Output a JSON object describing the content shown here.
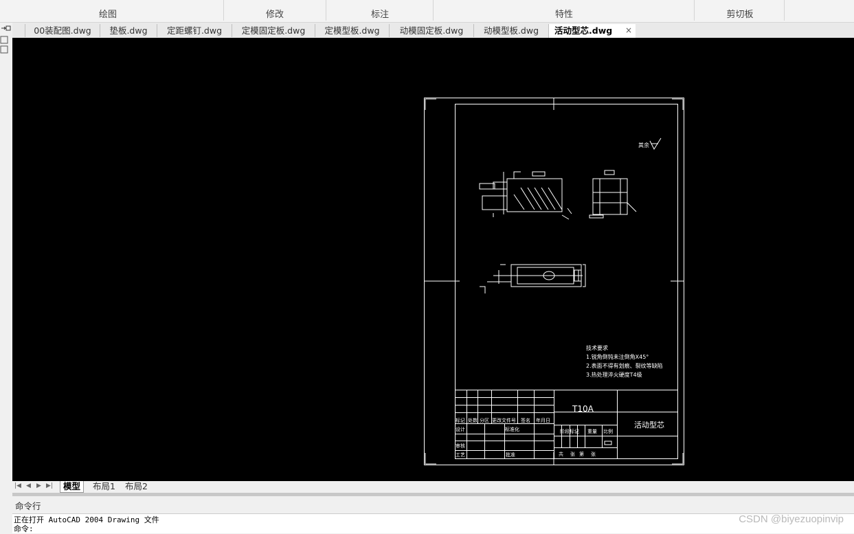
{
  "ribbon": {
    "panels": [
      {
        "label": "绘图"
      },
      {
        "label": "修改"
      },
      {
        "label": "标注"
      },
      {
        "label": "特性"
      },
      {
        "label": "剪切板"
      }
    ]
  },
  "doc_tabs": [
    {
      "label": "00装配图.dwg"
    },
    {
      "label": "垫板.dwg"
    },
    {
      "label": "定距螺钉.dwg"
    },
    {
      "label": "定模固定板.dwg"
    },
    {
      "label": "定模型板.dwg"
    },
    {
      "label": "动模固定板.dwg"
    },
    {
      "label": "动模型板.dwg"
    },
    {
      "label": "活动型芯.dwg",
      "active": true
    }
  ],
  "tab_close_glyph": "×",
  "layout_tabs": [
    {
      "label": "模型",
      "active": true
    },
    {
      "label": "布局1"
    },
    {
      "label": "布局2"
    }
  ],
  "command": {
    "label": "命令行",
    "history": [
      "正在打开 AutoCAD 2004 Drawing 文件",
      "命令:"
    ]
  },
  "drawing": {
    "roughness_note": "其余",
    "tech_req_title": "技术要求",
    "tech_req": [
      "1.锐角倒钝未注倒角X45°",
      "2.表面不得有划痕、裂纹等缺陷",
      "3.热处理淬火硬度T4级"
    ],
    "material": "T10A",
    "part_name": "活动型芯",
    "title_block_cells": {
      "mark": "标记",
      "count": "处数",
      "zone": "分区",
      "change_doc": "更改文件号",
      "sign": "签名",
      "date": "年月日",
      "design": "设计",
      "standardize": "标准化",
      "review": "审核",
      "process": "工艺",
      "approve": "批准",
      "stage_mark": "阶段标记",
      "weight": "重量",
      "scale": "比例",
      "total_sheets": "共",
      "sheet": "张",
      "sheet_no": "第",
      "sheet_no_end": "张"
    }
  },
  "watermark": "CSDN @biyezuopinvip",
  "colors": {
    "canvas": "#000000",
    "lines": "#ffffff",
    "ribbon": "#f3f3f3"
  }
}
